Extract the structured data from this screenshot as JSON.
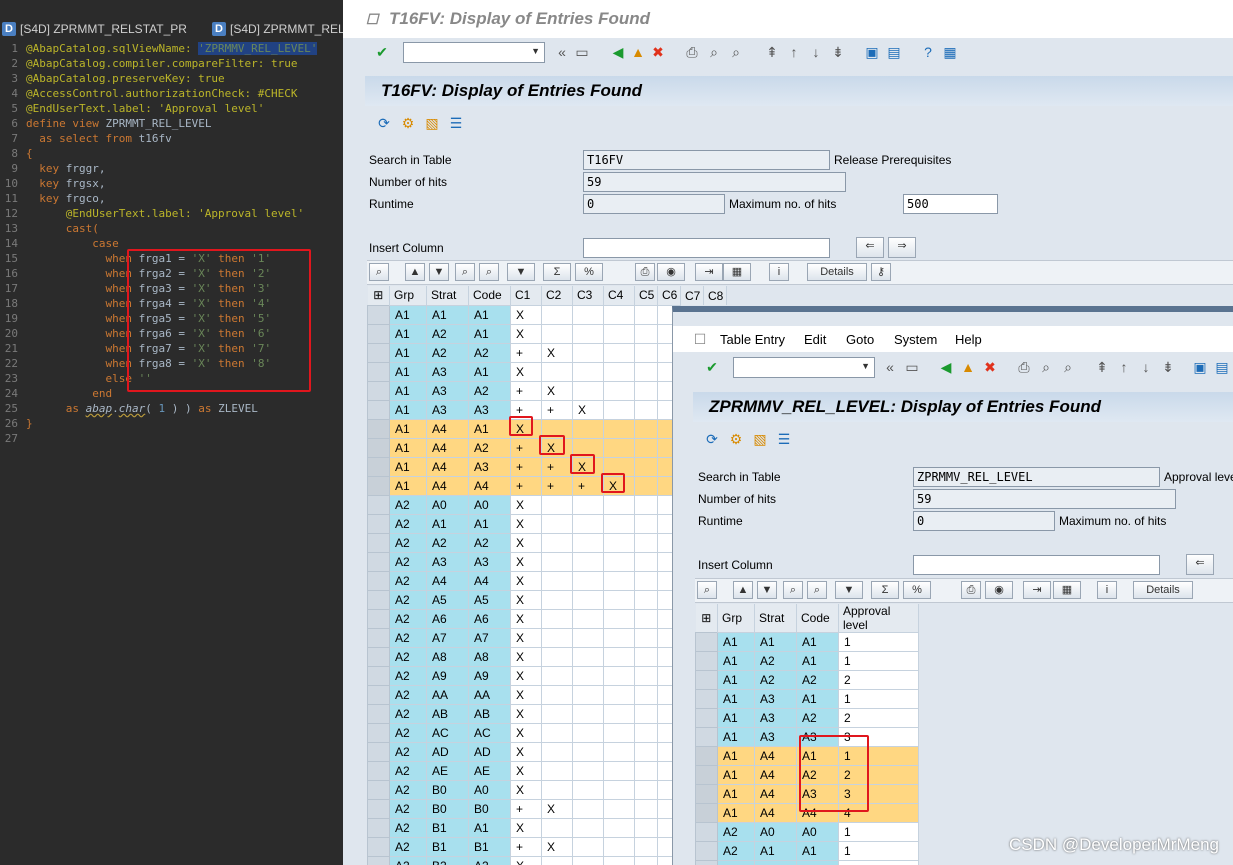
{
  "editor": {
    "tabs": [
      "[S4D] ZPRMMT_RELSTAT_PR",
      "[S4D] ZPRMMT_REL"
    ],
    "lines": [
      {
        "n": "1",
        "segs": [
          {
            "t": "@AbapCatalog.sqlViewName: ",
            "c": "an"
          },
          {
            "t": "'ZPRMMV_REL_LEVEL'",
            "c": "hl"
          }
        ]
      },
      {
        "n": "2",
        "segs": [
          {
            "t": "@AbapCatalog.compiler.compareFilter: true",
            "c": "an"
          }
        ]
      },
      {
        "n": "3",
        "segs": [
          {
            "t": "@AbapCatalog.preserveKey: true",
            "c": "an"
          }
        ]
      },
      {
        "n": "4",
        "segs": [
          {
            "t": "@AccessControl.authorizationCheck: #CHECK",
            "c": "an"
          }
        ]
      },
      {
        "n": "5",
        "segs": [
          {
            "t": "@EndUserText.label: 'Approval level'",
            "c": "an"
          }
        ]
      },
      {
        "n": "6",
        "segs": [
          {
            "t": "define view ",
            "c": "kw"
          },
          {
            "t": "ZPRMMT_REL_LEVEL",
            "c": ""
          }
        ]
      },
      {
        "n": "7",
        "segs": [
          {
            "t": "  as select from ",
            "c": "kw"
          },
          {
            "t": "t16fv",
            "c": ""
          }
        ]
      },
      {
        "n": "8",
        "segs": [
          {
            "t": "{",
            "c": "kw"
          }
        ]
      },
      {
        "n": "9",
        "segs": [
          {
            "t": "  key ",
            "c": "kw"
          },
          {
            "t": "frggr,",
            "c": ""
          }
        ]
      },
      {
        "n": "10",
        "segs": [
          {
            "t": "  key ",
            "c": "kw"
          },
          {
            "t": "frgsx,",
            "c": ""
          }
        ]
      },
      {
        "n": "11",
        "segs": [
          {
            "t": "  key ",
            "c": "kw"
          },
          {
            "t": "frgco,",
            "c": ""
          }
        ]
      },
      {
        "n": "12",
        "segs": [
          {
            "t": "      @EndUserText.label: 'Approval level'",
            "c": "an"
          }
        ]
      },
      {
        "n": "13",
        "segs": [
          {
            "t": "      cast(",
            "c": "kw"
          }
        ]
      },
      {
        "n": "14",
        "segs": [
          {
            "t": "          case",
            "c": "kw"
          }
        ]
      },
      {
        "n": "15",
        "segs": [
          {
            "t": "            when ",
            "c": "kw"
          },
          {
            "t": "frga1 = ",
            "c": ""
          },
          {
            "t": "'X'",
            "c": "st"
          },
          {
            "t": " then ",
            "c": "kw"
          },
          {
            "t": "'1'",
            "c": "st"
          }
        ]
      },
      {
        "n": "16",
        "segs": [
          {
            "t": "            when ",
            "c": "kw"
          },
          {
            "t": "frga2 = ",
            "c": ""
          },
          {
            "t": "'X'",
            "c": "st"
          },
          {
            "t": " then ",
            "c": "kw"
          },
          {
            "t": "'2'",
            "c": "st"
          }
        ]
      },
      {
        "n": "17",
        "segs": [
          {
            "t": "            when ",
            "c": "kw"
          },
          {
            "t": "frga3 = ",
            "c": ""
          },
          {
            "t": "'X'",
            "c": "st"
          },
          {
            "t": " then ",
            "c": "kw"
          },
          {
            "t": "'3'",
            "c": "st"
          }
        ]
      },
      {
        "n": "18",
        "segs": [
          {
            "t": "            when ",
            "c": "kw"
          },
          {
            "t": "frga4 = ",
            "c": ""
          },
          {
            "t": "'X'",
            "c": "st"
          },
          {
            "t": " then ",
            "c": "kw"
          },
          {
            "t": "'4'",
            "c": "st"
          }
        ]
      },
      {
        "n": "19",
        "segs": [
          {
            "t": "            when ",
            "c": "kw"
          },
          {
            "t": "frga5 = ",
            "c": ""
          },
          {
            "t": "'X'",
            "c": "st"
          },
          {
            "t": " then ",
            "c": "kw"
          },
          {
            "t": "'5'",
            "c": "st"
          }
        ]
      },
      {
        "n": "20",
        "segs": [
          {
            "t": "            when ",
            "c": "kw"
          },
          {
            "t": "frga6 = ",
            "c": ""
          },
          {
            "t": "'X'",
            "c": "st"
          },
          {
            "t": " then ",
            "c": "kw"
          },
          {
            "t": "'6'",
            "c": "st"
          }
        ]
      },
      {
        "n": "21",
        "segs": [
          {
            "t": "            when ",
            "c": "kw"
          },
          {
            "t": "frga7 = ",
            "c": ""
          },
          {
            "t": "'X'",
            "c": "st"
          },
          {
            "t": " then ",
            "c": "kw"
          },
          {
            "t": "'7'",
            "c": "st"
          }
        ]
      },
      {
        "n": "22",
        "segs": [
          {
            "t": "            when ",
            "c": "kw"
          },
          {
            "t": "frga8 = ",
            "c": ""
          },
          {
            "t": "'X'",
            "c": "st"
          },
          {
            "t": " then ",
            "c": "kw"
          },
          {
            "t": "'8'",
            "c": "st"
          }
        ]
      },
      {
        "n": "23",
        "segs": [
          {
            "t": "            else ",
            "c": "kw"
          },
          {
            "t": "''",
            "c": "st"
          }
        ]
      },
      {
        "n": "24",
        "segs": [
          {
            "t": "          end",
            "c": "kw"
          }
        ]
      },
      {
        "n": "25",
        "segs": [
          {
            "t": "      as ",
            "c": "kw"
          },
          {
            "t": "abap",
            "c": "it"
          },
          {
            "t": ".",
            "c": ""
          },
          {
            "t": "char",
            "c": "it"
          },
          {
            "t": "( ",
            "c": ""
          },
          {
            "t": "1",
            "c": "nm"
          },
          {
            "t": " ) ) ",
            "c": ""
          },
          {
            "t": "as ",
            "c": "kw"
          },
          {
            "t": "ZLEVEL",
            "c": ""
          }
        ]
      },
      {
        "n": "26",
        "segs": [
          {
            "t": "}",
            "c": "kw"
          }
        ]
      },
      {
        "n": "27",
        "segs": []
      }
    ]
  },
  "w1": {
    "title": "T16FV: Display of Entries Found",
    "header": "T16FV: Display of Entries Found",
    "search_label": "Search in Table",
    "search_value": "T16FV",
    "search_desc": "Release Prerequisites",
    "hits_label": "Number of hits",
    "hits_value": "59",
    "runtime_label": "Runtime",
    "runtime_value": "0",
    "max_label": "Maximum no. of hits",
    "max_value": "500",
    "insert_label": "Insert Column",
    "details": "Details",
    "columns": [
      "Grp",
      "Strat",
      "Code",
      "C1",
      "C2",
      "C3",
      "C4",
      "C5",
      "C6",
      "C7",
      "C8"
    ],
    "rows": [
      [
        "A1",
        "A1",
        "A1",
        "X",
        "",
        "",
        "",
        "",
        ""
      ],
      [
        "A1",
        "A2",
        "A1",
        "X",
        "",
        "",
        "",
        "",
        ""
      ],
      [
        "A1",
        "A2",
        "A2",
        "+",
        "X",
        "",
        "",
        "",
        ""
      ],
      [
        "A1",
        "A3",
        "A1",
        "X",
        "",
        "",
        "",
        "",
        ""
      ],
      [
        "A1",
        "A3",
        "A2",
        "+",
        "X",
        "",
        "",
        "",
        ""
      ],
      [
        "A1",
        "A3",
        "A3",
        "+",
        "+",
        "X",
        "",
        "",
        ""
      ],
      [
        "A1",
        "A4",
        "A1",
        "X",
        "",
        "",
        "",
        "",
        ""
      ],
      [
        "A1",
        "A4",
        "A2",
        "+",
        "X",
        "",
        "",
        "",
        ""
      ],
      [
        "A1",
        "A4",
        "A3",
        "+",
        "+",
        "X",
        "",
        "",
        ""
      ],
      [
        "A1",
        "A4",
        "A4",
        "+",
        "+",
        "+",
        "X",
        "",
        ""
      ],
      [
        "A2",
        "A0",
        "A0",
        "X",
        "",
        "",
        "",
        "",
        ""
      ],
      [
        "A2",
        "A1",
        "A1",
        "X",
        "",
        "",
        "",
        "",
        ""
      ],
      [
        "A2",
        "A2",
        "A2",
        "X",
        "",
        "",
        "",
        "",
        ""
      ],
      [
        "A2",
        "A3",
        "A3",
        "X",
        "",
        "",
        "",
        "",
        ""
      ],
      [
        "A2",
        "A4",
        "A4",
        "X",
        "",
        "",
        "",
        "",
        ""
      ],
      [
        "A2",
        "A5",
        "A5",
        "X",
        "",
        "",
        "",
        "",
        ""
      ],
      [
        "A2",
        "A6",
        "A6",
        "X",
        "",
        "",
        "",
        "",
        ""
      ],
      [
        "A2",
        "A7",
        "A7",
        "X",
        "",
        "",
        "",
        "",
        ""
      ],
      [
        "A2",
        "A8",
        "A8",
        "X",
        "",
        "",
        "",
        "",
        ""
      ],
      [
        "A2",
        "A9",
        "A9",
        "X",
        "",
        "",
        "",
        "",
        ""
      ],
      [
        "A2",
        "AA",
        "AA",
        "X",
        "",
        "",
        "",
        "",
        ""
      ],
      [
        "A2",
        "AB",
        "AB",
        "X",
        "",
        "",
        "",
        "",
        ""
      ],
      [
        "A2",
        "AC",
        "AC",
        "X",
        "",
        "",
        "",
        "",
        ""
      ],
      [
        "A2",
        "AD",
        "AD",
        "X",
        "",
        "",
        "",
        "",
        ""
      ],
      [
        "A2",
        "AE",
        "AE",
        "X",
        "",
        "",
        "",
        "",
        ""
      ],
      [
        "A2",
        "B0",
        "A0",
        "X",
        "",
        "",
        "",
        "",
        ""
      ],
      [
        "A2",
        "B0",
        "B0",
        "+",
        "X",
        "",
        "",
        "",
        ""
      ],
      [
        "A2",
        "B1",
        "A1",
        "X",
        "",
        "",
        "",
        "",
        ""
      ],
      [
        "A2",
        "B1",
        "B1",
        "+",
        "X",
        "",
        "",
        "",
        ""
      ],
      [
        "A2",
        "B2",
        "A2",
        "X",
        "",
        "",
        "",
        "",
        ""
      ]
    ]
  },
  "w2": {
    "menu": [
      "Table Entry",
      "Edit",
      "Goto",
      "System",
      "Help"
    ],
    "header": "ZPRMMV_REL_LEVEL: Display of Entries Found",
    "search_label": "Search in Table",
    "search_value": "ZPRMMV_REL_LEVEL",
    "search_desc": "Approval leve",
    "hits_label": "Number of hits",
    "hits_value": "59",
    "runtime_label": "Runtime",
    "runtime_value": "0",
    "max_label": "Maximum no. of hits",
    "insert_label": "Insert Column",
    "details": "Details",
    "columns": [
      "Grp",
      "Strat",
      "Code",
      "Approval level"
    ],
    "rows": [
      [
        "A1",
        "A1",
        "A1",
        "1"
      ],
      [
        "A1",
        "A2",
        "A1",
        "1"
      ],
      [
        "A1",
        "A2",
        "A2",
        "2"
      ],
      [
        "A1",
        "A3",
        "A1",
        "1"
      ],
      [
        "A1",
        "A3",
        "A2",
        "2"
      ],
      [
        "A1",
        "A3",
        "A3",
        "3"
      ],
      [
        "A1",
        "A4",
        "A1",
        "1"
      ],
      [
        "A1",
        "A4",
        "A2",
        "2"
      ],
      [
        "A1",
        "A4",
        "A3",
        "3"
      ],
      [
        "A1",
        "A4",
        "A4",
        "4"
      ],
      [
        "A2",
        "A0",
        "A0",
        "1"
      ],
      [
        "A2",
        "A1",
        "A1",
        "1"
      ],
      [
        "A2",
        "A2",
        "A2",
        "1"
      ]
    ]
  },
  "watermark": "CSDN @DeveloperMrMeng",
  "colors": {
    "key_col": "#a8e0ee",
    "highlight": "#ffd782",
    "highlight_box": "#e0161d",
    "editor_bg": "#2b2b2b"
  }
}
